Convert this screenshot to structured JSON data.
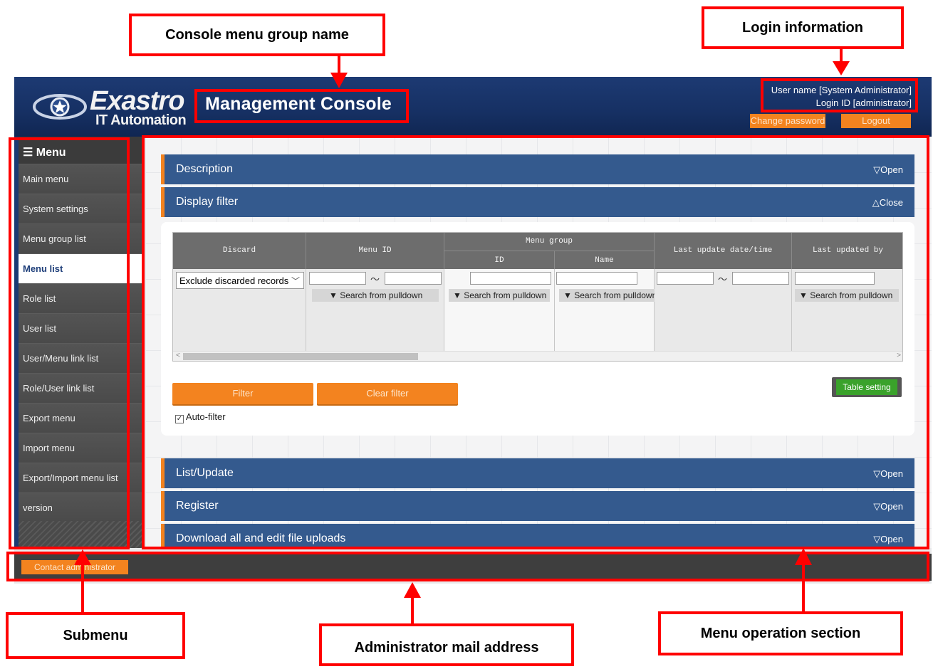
{
  "header": {
    "logo_word": "Exastro",
    "logo_sub": "IT Automation",
    "console_title": "Management Console",
    "login_user": "User name [System Administrator]",
    "login_id": "Login ID [administrator]",
    "change_password": "Change password",
    "logout": "Logout"
  },
  "sidebar": {
    "title": "☰ Menu",
    "items": [
      {
        "label": "Main menu"
      },
      {
        "label": "System settings"
      },
      {
        "label": "Menu group list"
      },
      {
        "label": "Menu list",
        "active": true
      },
      {
        "label": "Role list"
      },
      {
        "label": "User list"
      },
      {
        "label": "User/Menu link list"
      },
      {
        "label": "Role/User link list"
      },
      {
        "label": "Export menu"
      },
      {
        "label": "Import menu"
      },
      {
        "label": "Export/Import menu list"
      },
      {
        "label": "version"
      }
    ]
  },
  "sections": {
    "description": {
      "label": "Description",
      "toggle": "▽Open"
    },
    "display_filter": {
      "label": "Display filter",
      "toggle": "△Close"
    },
    "list_update": {
      "label": "List/Update",
      "toggle": "▽Open"
    },
    "register": {
      "label": "Register",
      "toggle": "▽Open"
    },
    "download": {
      "label": "Download all and edit file uploads",
      "toggle": "▽Open"
    }
  },
  "filter": {
    "headers": {
      "discard": "Discard",
      "menu_id": "Menu ID",
      "menu_group": "Menu group",
      "group_id": "ID",
      "group_name": "Name",
      "last_update": "Last update date/time",
      "last_updated_by": "Last updated by"
    },
    "discard_value": "Exclude discarded records",
    "tilde": "～",
    "pulldown": "▼ Search from pulldown",
    "filter_button": "Filter",
    "clear_button": "Clear filter",
    "table_setting": "Table setting",
    "autofilter": "Auto-filter",
    "autofilter_checked": true
  },
  "footer": {
    "contact": "Contact administrator"
  },
  "annotations": {
    "console_menu_group_name": "Console menu group name",
    "login_information": "Login information",
    "submenu": "Submenu",
    "administrator_mail": "Administrator mail address",
    "menu_operation": "Menu operation section"
  },
  "colors": {
    "header_blue": "#163063",
    "accent_orange": "#f3831f",
    "section_blue": "#345a8e",
    "annotation_red": "#ff0000",
    "table_setting_green": "#3aa22b"
  }
}
